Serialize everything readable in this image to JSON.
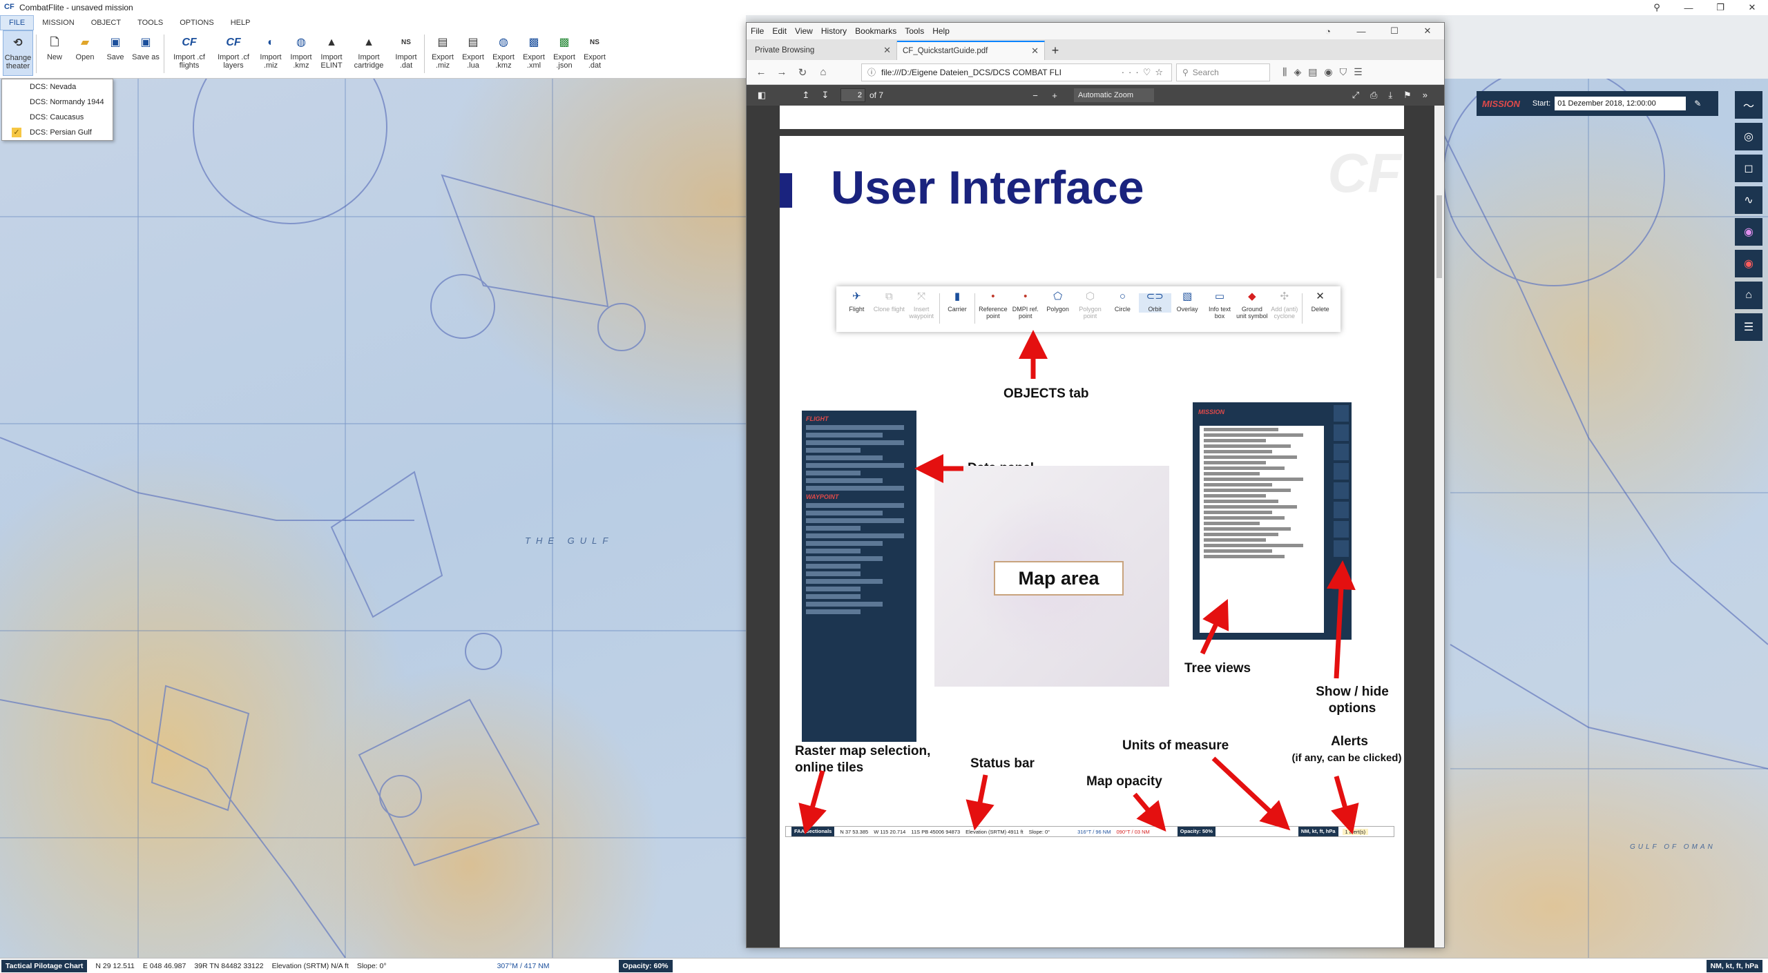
{
  "app": {
    "title": "CombatFlite  -  unsaved mission",
    "logo": "CF"
  },
  "menu": {
    "items": [
      "FILE",
      "MISSION",
      "OBJECT",
      "TOOLS",
      "OPTIONS",
      "HELP"
    ]
  },
  "ribbon": {
    "change_theater": "Change theater",
    "new": "New",
    "open": "Open",
    "save": "Save",
    "save_as": "Save as",
    "import_flights": "Import .cf flights",
    "import_layers": "Import .cf layers",
    "import_miz": "Import .miz",
    "import_kmz": "Import .kmz",
    "import_elint": "Import ELINT",
    "import_cartridge": "Import cartridge",
    "import_dat": "Import .dat",
    "export_miz": "Export .miz",
    "export_lua": "Export .lua",
    "export_kmz": "Export .kmz",
    "export_xml": "Export .xml",
    "export_json": "Export .json",
    "export_dat": "Export .dat"
  },
  "theater_menu": {
    "items": [
      "DCS: Nevada",
      "DCS: Normandy 1944",
      "DCS: Caucasus",
      "DCS: Persian Gulf"
    ],
    "checked": "DCS: Persian Gulf"
  },
  "map": {
    "sea_label": "THE GULF",
    "gulf_of_oman": "GULF OF OMAN"
  },
  "mission_panel": {
    "title": "MISSION",
    "start_label": "Start:",
    "start_date": "01 Dezember 2018, 12:00:00"
  },
  "statusbar": {
    "map": "Tactical Pilotage Chart",
    "lat": "N 29 12.511",
    "lon": "E 048 46.987",
    "mgrs": "39R TN 84482 33122",
    "elevation": "Elevation (SRTM) N/A ft",
    "slope": "Slope: 0°",
    "bearing": "307°M / 417 NM",
    "opacity": "Opacity: 60%",
    "units": "NM, kt, ft, hPa"
  },
  "firefox": {
    "menu": [
      "File",
      "Edit",
      "View",
      "History",
      "Bookmarks",
      "Tools",
      "Help"
    ],
    "tabs": [
      "Private Browsing",
      "CF_QuickstartGuide.pdf"
    ],
    "url": "file:///D:/Eigene Dateien_DCS/DCS COMBAT FLI",
    "search_placeholder": "Search",
    "pdf_page": "2",
    "pdf_total": "of 7",
    "pdf_zoom": "Automatic Zoom"
  },
  "pdf": {
    "title": "User Interface",
    "watermark": "CF",
    "objects_tab": "OBJECTS tab",
    "data_panel": "Data panel",
    "map_area": "Map area",
    "tree_views": "Tree views",
    "show_hide": "Show / hide options",
    "raster": "Raster map selection, online tiles",
    "status_bar": "Status bar",
    "units": "Units of measure",
    "map_opacity": "Map opacity",
    "alerts": "Alerts",
    "alerts_sub": "(if any, can be clicked)",
    "object_buttons": [
      "Flight",
      "Clone flight",
      "Insert waypoint",
      "Carrier",
      "Reference point",
      "DMPI ref. point",
      "Polygon",
      "Polygon point",
      "Circle",
      "Orbit",
      "Overlay",
      "Info text box",
      "Ground unit symbol",
      "Add (anti) cyclone",
      "Delete"
    ],
    "dp_flight": "FLIGHT",
    "dp_waypoint": "WAYPOINT",
    "tree_mission": "MISSION",
    "strip": {
      "map": "FAA Sectionals",
      "lat": "N 37 53.385",
      "lon": "W 115 20.714",
      "mgrs": "11S PB 45006 94873",
      "elev": "Elevation (SRTM) 4911 ft",
      "slope": "Slope: 0°",
      "bearing": "316°T / 96 NM",
      "bearing2": "090°T / 03 NM",
      "opacity": "Opacity: 50%",
      "units": "NM, kt, ft, hPa",
      "alerts": "1 alert(s)"
    }
  }
}
